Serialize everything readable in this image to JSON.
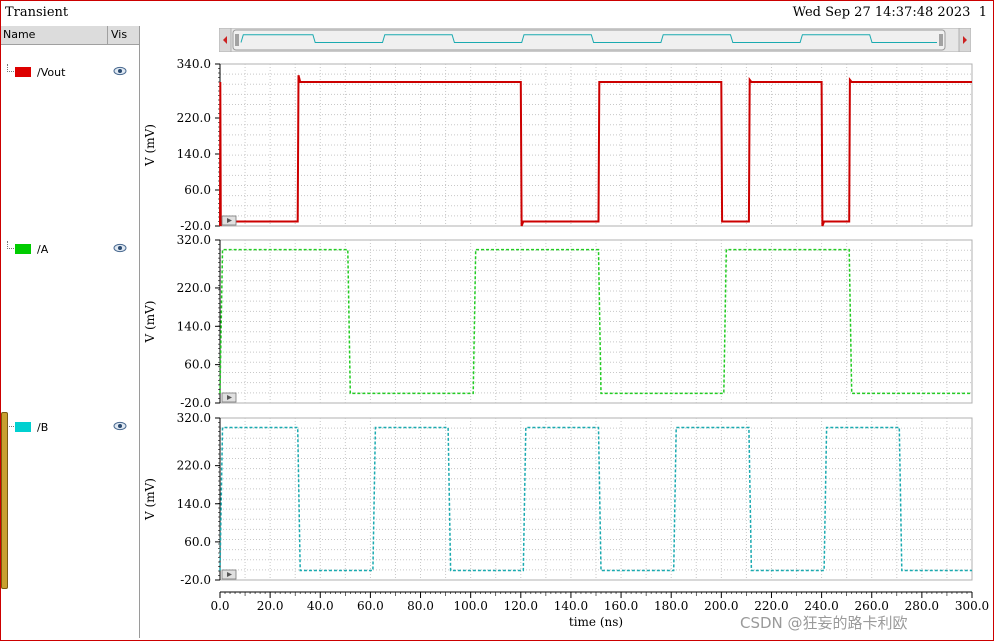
{
  "window": {
    "title": "Transient",
    "timestamp": "Wed Sep 27 14:37:48 2023",
    "page_number": "1"
  },
  "panel": {
    "name_header": "Name",
    "vis_header": "Vis",
    "visibility_icon": "eye-icon",
    "signals": [
      {
        "label": "/Vout",
        "color": "#dd0000"
      },
      {
        "label": "/A",
        "color": "#00cc00"
      },
      {
        "label": "/B",
        "color": "#00d0d0"
      }
    ]
  },
  "watermark": "CSDN @狂妄的路卡利欧",
  "chart_data": {
    "type": "line",
    "xlabel": "time (ns)",
    "xlim": [
      0,
      300
    ],
    "x_ticks": [
      "0.0",
      "20.0",
      "40.0",
      "60.0",
      "80.0",
      "100.0",
      "120.0",
      "140.0",
      "160.0",
      "180.0",
      "200.0",
      "220.0",
      "240.0",
      "260.0",
      "280.0",
      "300.0"
    ],
    "grid": true,
    "panels": [
      {
        "name": "/Vout",
        "ylabel": "V (mV)",
        "ylim": [
          -20,
          340
        ],
        "y_ticks": [
          "340.0",
          "220.0",
          "140.0",
          "60.0",
          "-20.0"
        ],
        "y_tick_values": [
          340,
          220,
          140,
          60,
          -20
        ],
        "color": "#cc0000",
        "dashed": false,
        "x": [
          0,
          0.1,
          0.3,
          0.5,
          1,
          31,
          31.3,
          32,
          120,
          120.3,
          121,
          151,
          151.3,
          152,
          200,
          200.3,
          201,
          211,
          211.3,
          212,
          240,
          240.3,
          241,
          251,
          251.3,
          252,
          300
        ],
        "y": [
          -20,
          300,
          -20,
          -10,
          -10,
          -10,
          315,
          300,
          300,
          -20,
          -10,
          -10,
          300,
          300,
          300,
          -10,
          -10,
          -10,
          305,
          300,
          300,
          -20,
          -10,
          -10,
          305,
          300,
          300
        ]
      },
      {
        "name": "/A",
        "ylabel": "V (mV)",
        "ylim": [
          -20,
          320
        ],
        "y_ticks": [
          "320.0",
          "220.0",
          "140.0",
          "60.0",
          "-20.0"
        ],
        "y_tick_values": [
          320,
          220,
          140,
          60,
          -20
        ],
        "color": "#22cc22",
        "dashed": true,
        "x": [
          0,
          1,
          51,
          52,
          101,
          102,
          151,
          152,
          201,
          202,
          251,
          252,
          300
        ],
        "y": [
          0,
          300,
          300,
          0,
          0,
          300,
          300,
          0,
          0,
          300,
          300,
          0,
          0
        ]
      },
      {
        "name": "/B",
        "ylabel": "V (mV)",
        "ylim": [
          -20,
          320
        ],
        "y_ticks": [
          "320.0",
          "220.0",
          "140.0",
          "60.0",
          "-20.0"
        ],
        "y_tick_values": [
          320,
          220,
          140,
          60,
          -20
        ],
        "color": "#1aaab0",
        "dashed": true,
        "x": [
          0,
          1,
          31,
          32,
          61,
          62,
          91,
          92,
          121,
          122,
          151,
          152,
          181,
          182,
          211,
          212,
          241,
          242,
          271,
          272,
          300
        ],
        "y": [
          0,
          300,
          300,
          0,
          0,
          300,
          300,
          0,
          0,
          300,
          300,
          0,
          0,
          300,
          300,
          0,
          0,
          300,
          300,
          0,
          0
        ]
      }
    ]
  }
}
